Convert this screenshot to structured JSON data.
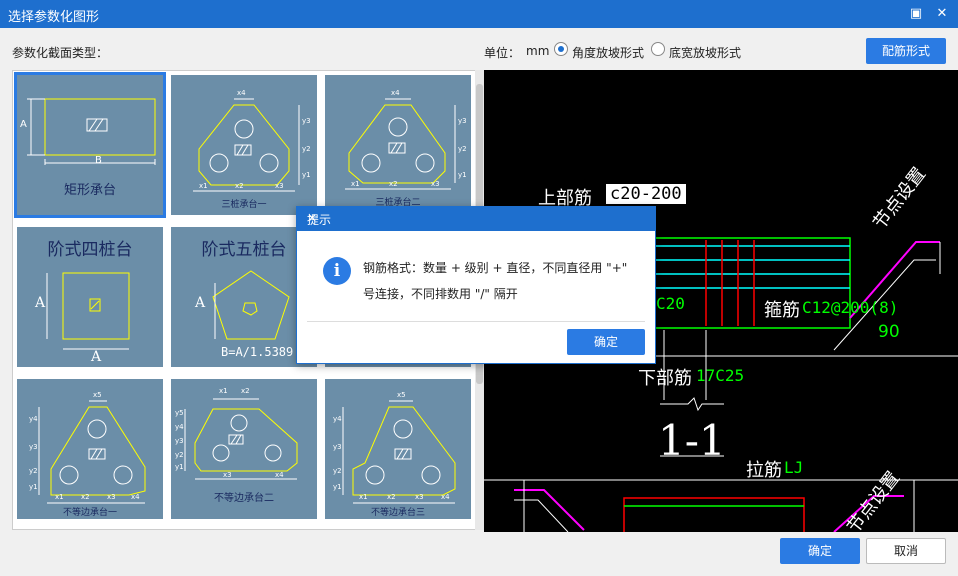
{
  "window": {
    "title": "选择参数化图形"
  },
  "toolbar": {
    "section_type_label": "参数化截面类型：",
    "unit_label": "单位：",
    "unit_value": "mm",
    "option_angle": "角度放坡形式",
    "option_width": "底宽放坡形式",
    "selected_option": "角度放坡形式",
    "rebar_button": "配筋形式"
  },
  "gallery": {
    "tiles": [
      {
        "caption": "矩形承台",
        "labels": {
          "a": "A",
          "b": "B"
        },
        "selected": true
      },
      {
        "caption": "三桩承台一",
        "labels": {
          "x4": "x4",
          "y1": "y1",
          "y2": "y2",
          "y3": "y3",
          "x1": "x1",
          "x2": "x2",
          "x3": "x3"
        }
      },
      {
        "caption": "三桩承台二",
        "labels": {
          "x4": "x4",
          "y1": "y1",
          "y2": "y2",
          "y3": "y3",
          "x1": "x1",
          "x2": "x2",
          "x3": "x3"
        }
      },
      {
        "caption": "阶式四桩台",
        "labels": {
          "a1": "A",
          "a2": "A"
        }
      },
      {
        "caption": "阶式五桩台",
        "labels": {
          "a": "A",
          "formula": "B=A/1.5389"
        }
      },
      {
        "caption": "",
        "labels": {}
      },
      {
        "caption": "不等边承台一",
        "labels": {
          "x5": "x5",
          "y1": "y1",
          "y2": "y2",
          "y3": "y3",
          "y4": "y4",
          "x1": "x1",
          "x2": "x2",
          "x3": "x3",
          "x4": "x4"
        }
      },
      {
        "caption": "不等边承台二",
        "labels": {
          "x1": "x1",
          "x2": "x2",
          "y1": "y1",
          "y2": "y2",
          "y3": "y3",
          "y4": "y4",
          "y5": "y5",
          "x3": "x3",
          "x4": "x4"
        }
      },
      {
        "caption": "不等边承台三",
        "labels": {
          "x5": "x5",
          "y1": "y1",
          "y2": "y2",
          "y3": "y3",
          "y4": "y4",
          "x1": "x1",
          "x2": "x2",
          "x3": "x3",
          "x4": "x4"
        }
      }
    ]
  },
  "preview": {
    "top_bar_label": "上部筋",
    "top_bar_value": "c20-200",
    "node_setting": "节点设置",
    "node_setting_2": "节点设置",
    "stirrup_label": "箍筋",
    "stirrup_value": "C12@200(8)",
    "angle_value": "90",
    "side_value": "C20",
    "bottom_bar_label": "下部筋",
    "bottom_bar_value": "17C25",
    "section_label": "1-1",
    "tie_label": "拉筋",
    "tie_value": "LJ"
  },
  "dialog": {
    "title": "提示",
    "message": "钢筋格式：数量 + 级别 + 直径，不同直径用 \"+\" 号连接，不同排数用 \"/\" 隔开",
    "ok": "确定"
  },
  "footer": {
    "ok": "确定",
    "cancel": "取消"
  },
  "colors": {
    "accent": "#2b7be3",
    "titlebar": "#1e6fce",
    "tile_bg": "#6b8ea8",
    "shape": "#ffff00"
  }
}
